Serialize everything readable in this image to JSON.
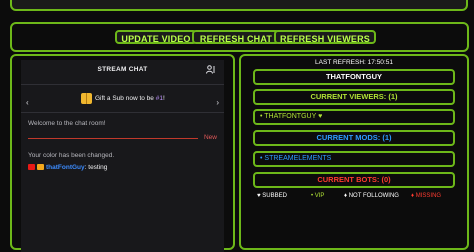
{
  "buttons": {
    "update_video": "UPDATE VIDEO",
    "refresh_chat": "REFRESH CHAT",
    "refresh_viewers": "REFRESH VIEWERS"
  },
  "chat": {
    "title": "STREAM CHAT",
    "gift_prefix": "Gift a Sub now to be ",
    "gift_highlight": "#1",
    "gift_suffix": "!",
    "welcome": "Welcome to the chat room!",
    "new_label": "New",
    "color_changed": "Your color has been changed.",
    "message": {
      "username": "thatFontGuy",
      "separator": ":",
      "text": " testing"
    }
  },
  "viewers": {
    "last_refresh_label": "LAST REFRESH:",
    "last_refresh_time": "17:50:51",
    "channel_name": "THATFONTGUY",
    "current_viewers_label": "CURRENT VIEWERS: (1)",
    "viewer_list": [
      "• THATFONTGUY ♥"
    ],
    "current_mods_label": "CURRENT MODS: (1)",
    "mods_list": [
      "• STREAMELEMENTS"
    ],
    "current_bots_label": "CURRENT BOTS: (0)",
    "legend": {
      "subbed": "♥ SUBBED",
      "vip": "• VIP",
      "not_following": "♦ NOT FOLLOWING",
      "missing": "♦ MISSING"
    }
  },
  "colors": {
    "accent_green": "#6db819",
    "button_text": "#b9ff4a",
    "viewers_header": "#b0e336",
    "mods_header": "#2f9bff",
    "bots_header": "#ff3b30",
    "chat_username": "#3c8cff",
    "new_line": "#c0392b"
  }
}
